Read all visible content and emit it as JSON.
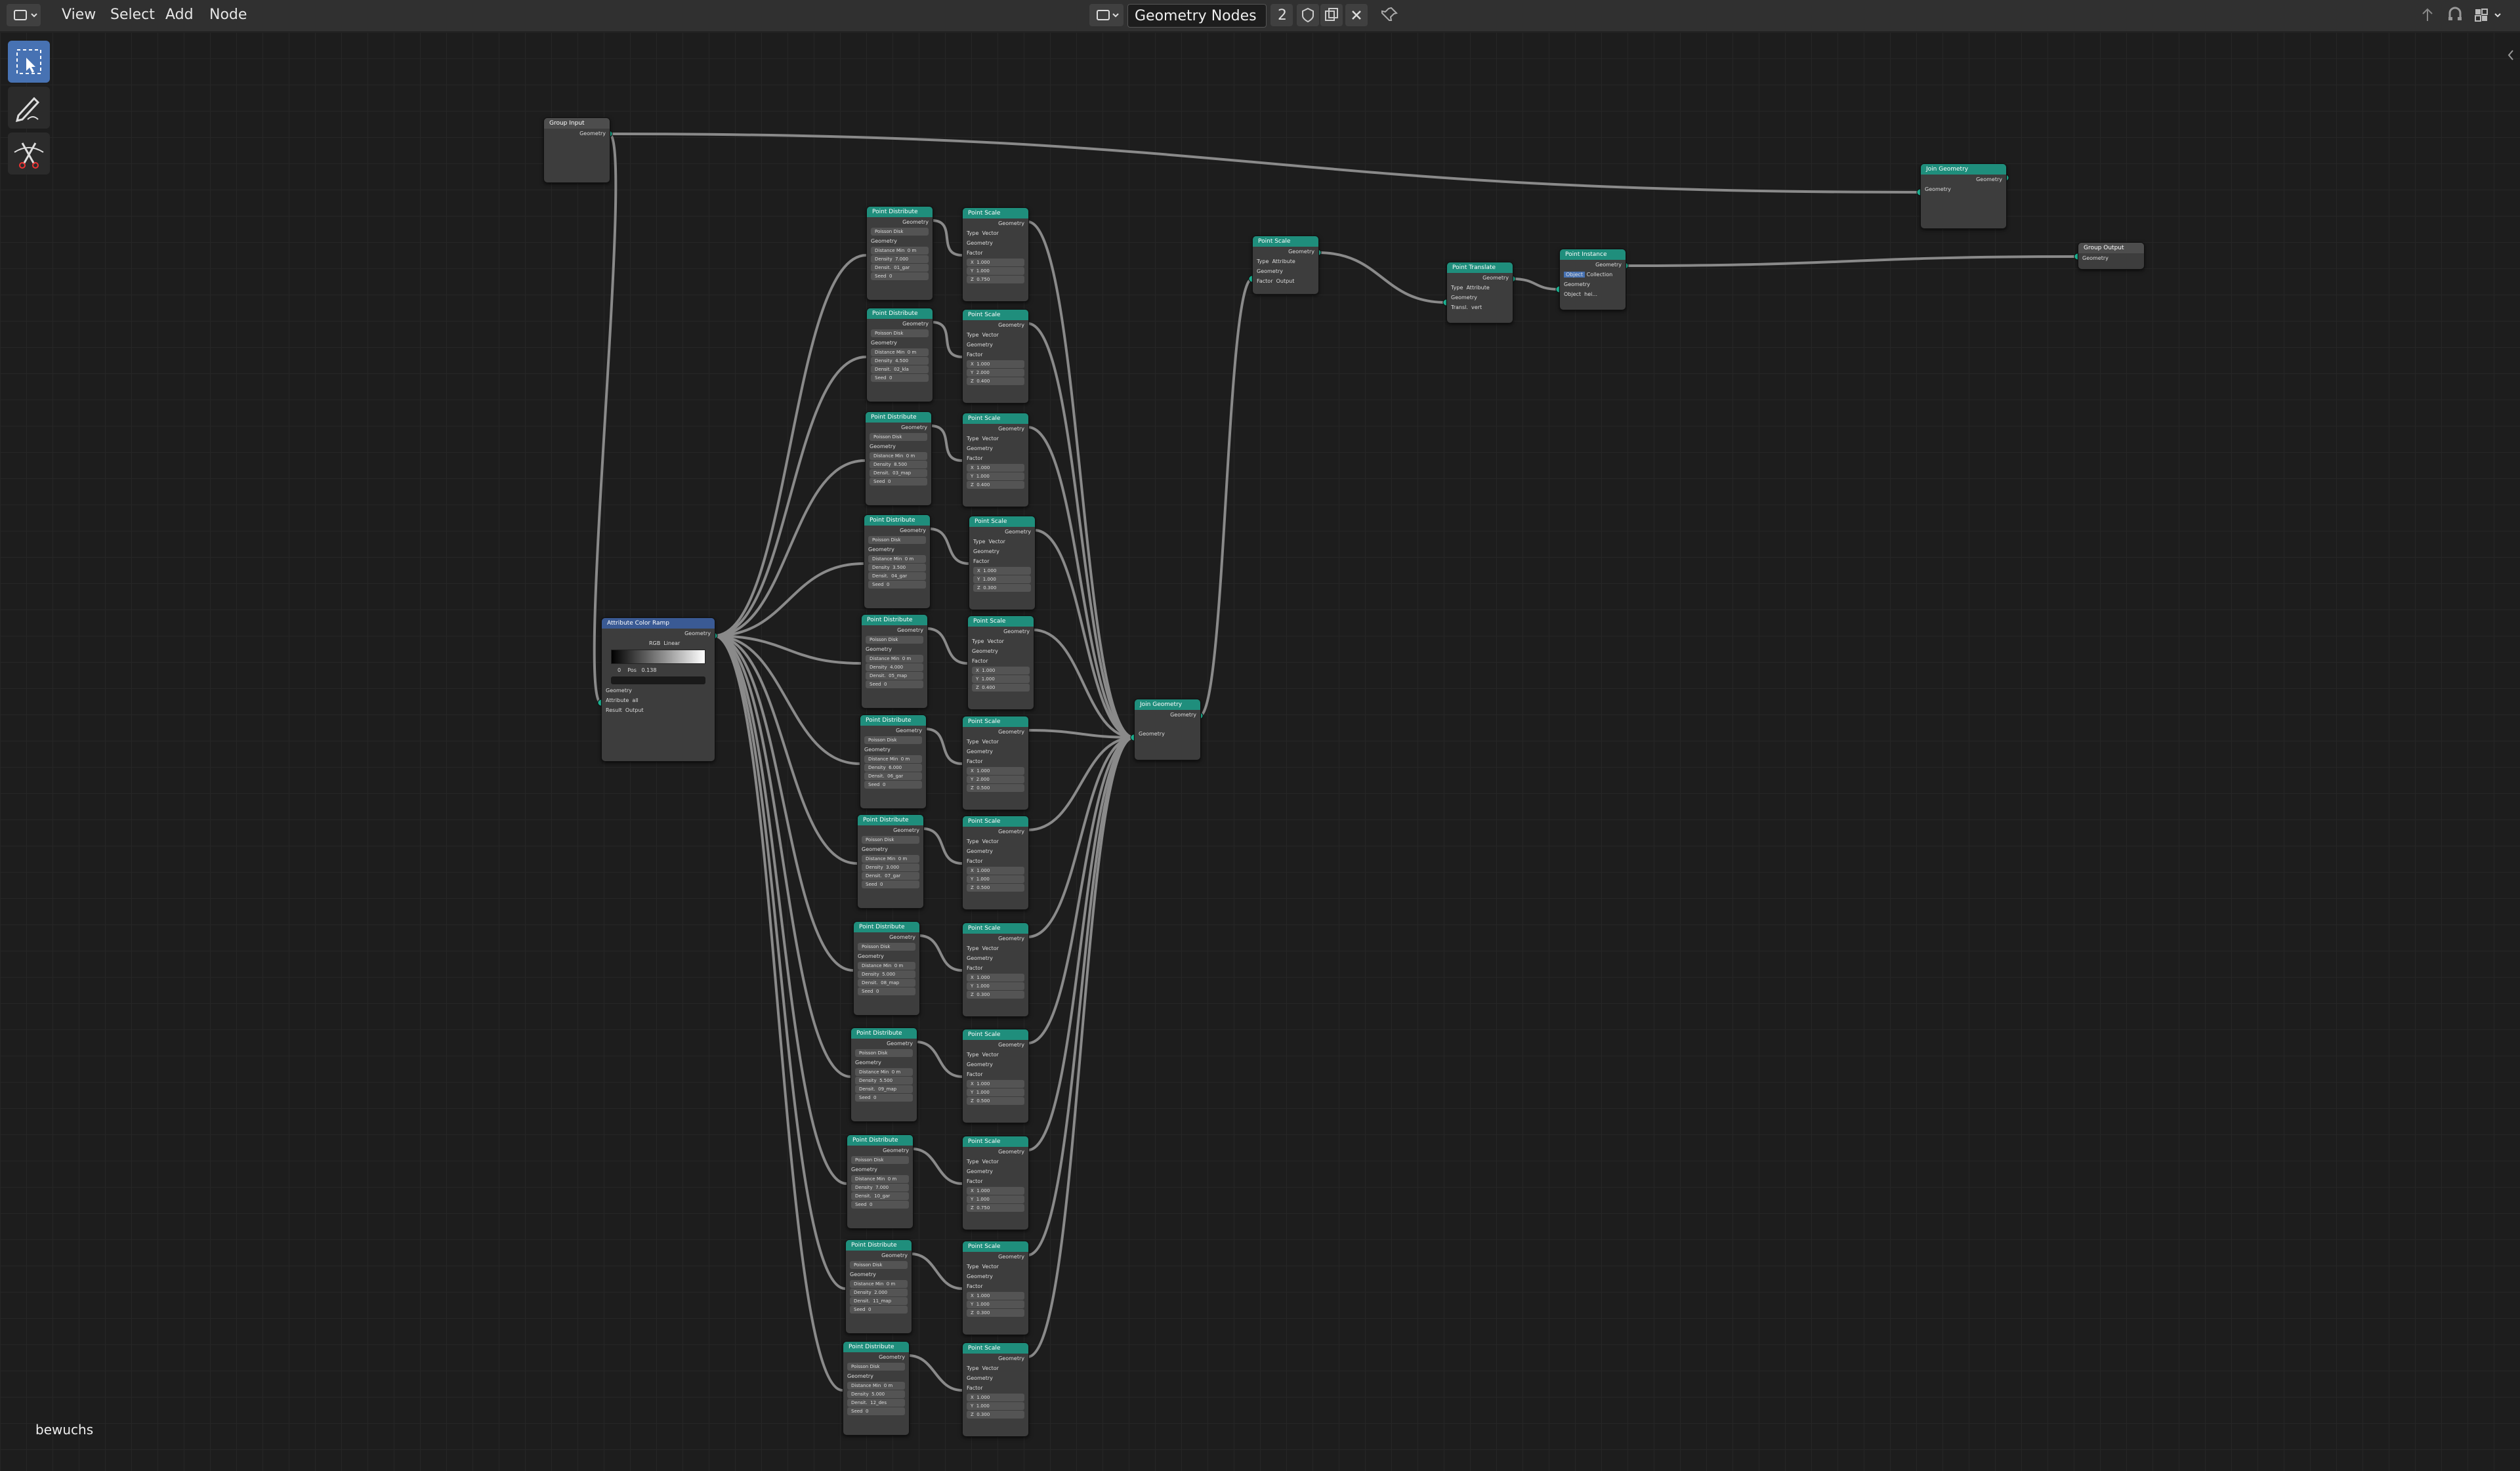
{
  "header": {
    "menu": [
      "View",
      "Select",
      "Add",
      "Node"
    ],
    "tree_name": "Geometry Nodes",
    "user_count": "2"
  },
  "colors": {
    "geometry_socket": "#1fc8a4",
    "node_header": "#1f8e7c",
    "selection": "#4772b3"
  },
  "toolbar": {
    "tools": [
      "select-box-icon",
      "annotate-icon",
      "cut-links-icon"
    ]
  },
  "object_label": "bewuchs",
  "nodes": {
    "group_input": {
      "title": "Group Input",
      "out": "Geometry"
    },
    "group_output": {
      "title": "Group Output",
      "in": "Geometry"
    },
    "join_top": {
      "title": "Join Geometry",
      "out": "Geometry",
      "in": "Geometry"
    },
    "join_main": {
      "title": "Join Geometry",
      "out": "Geometry",
      "in": "Geometry"
    },
    "point_scale_main": {
      "title": "Point Scale",
      "out": "Geometry",
      "type_label": "Type",
      "type_val": "Attribute",
      "in": "Geometry",
      "factor": "Factor",
      "factor_val": "Output"
    },
    "point_translate": {
      "title": "Point Translate",
      "out": "Geometry",
      "type_label": "Type",
      "type_val": "Attribute",
      "in": "Geometry",
      "trans": "Transl.",
      "trans_val": "vert"
    },
    "point_instance": {
      "title": "Point Instance",
      "out": "Geometry",
      "object": "Object",
      "collection": "Collection",
      "in": "Geometry",
      "obj_label": "Object",
      "obj_val": "hei..."
    },
    "color_ramp": {
      "title": "Attribute Color Ramp",
      "out": "Geometry",
      "mode": "RGB",
      "interp": "Linear",
      "pos_idx": "0",
      "pos_label": "Pos",
      "pos_val": "0.138",
      "in": "Geometry",
      "attr": "Attribute",
      "attr_val": "all",
      "result": "Result",
      "result_val": "Output"
    }
  },
  "distribute_template": {
    "title": "Point Distribute",
    "out": "Geometry",
    "method": "Poisson Disk",
    "in": "Geometry",
    "dist": "Distance Min",
    "dens": "Density",
    "densattr": "Densit.",
    "seed": "Seed"
  },
  "scale_template": {
    "title": "Point Scale",
    "out": "Geometry",
    "type_label": "Type",
    "type_val": "Vector",
    "in": "Geometry",
    "factor": "Factor",
    "x": "X",
    "y": "Y",
    "z": "Z"
  },
  "distributes": [
    {
      "dist": "0 m",
      "dens": "7.000",
      "attr": "01_gar",
      "seed": "0"
    },
    {
      "dist": "0 m",
      "dens": "4.500",
      "attr": "02_kla",
      "seed": "0"
    },
    {
      "dist": "0 m",
      "dens": "8.500",
      "attr": "03_map",
      "seed": "0"
    },
    {
      "dist": "0 m",
      "dens": "3.500",
      "attr": "04_gar",
      "seed": "0"
    },
    {
      "dist": "0 m",
      "dens": "4.000",
      "attr": "05_map",
      "seed": "0"
    },
    {
      "dist": "0 m",
      "dens": "6.000",
      "attr": "06_gar",
      "seed": "0"
    },
    {
      "dist": "0 m",
      "dens": "3.000",
      "attr": "07_gar",
      "seed": "0"
    },
    {
      "dist": "0 m",
      "dens": "5.000",
      "attr": "08_map",
      "seed": "0"
    },
    {
      "dist": "0 m",
      "dens": "5.500",
      "attr": "09_map",
      "seed": "0"
    },
    {
      "dist": "0 m",
      "dens": "7.000",
      "attr": "10_gar",
      "seed": "0"
    },
    {
      "dist": "0 m",
      "dens": "2.000",
      "attr": "11_map",
      "seed": "0"
    },
    {
      "dist": "0 m",
      "dens": "5.000",
      "attr": "12_des",
      "seed": "0"
    }
  ],
  "scales": [
    {
      "x": "1.000",
      "y": "1.000",
      "z": "0.750"
    },
    {
      "x": "1.000",
      "y": "2.000",
      "z": "0.400"
    },
    {
      "x": "1.000",
      "y": "1.000",
      "z": "0.400"
    },
    {
      "x": "1.000",
      "y": "1.000",
      "z": "0.300"
    },
    {
      "x": "1.000",
      "y": "1.000",
      "z": "0.400"
    },
    {
      "x": "1.000",
      "y": "2.000",
      "z": "0.500"
    },
    {
      "x": "1.000",
      "y": "1.000",
      "z": "0.500"
    },
    {
      "x": "1.000",
      "y": "1.000",
      "z": "0.300"
    },
    {
      "x": "1.000",
      "y": "1.000",
      "z": "0.500"
    },
    {
      "x": "1.000",
      "y": "1.000",
      "z": "0.750"
    },
    {
      "x": "1.000",
      "y": "1.000",
      "z": "0.300"
    },
    {
      "x": "1.000",
      "y": "1.000",
      "z": "0.300"
    }
  ]
}
